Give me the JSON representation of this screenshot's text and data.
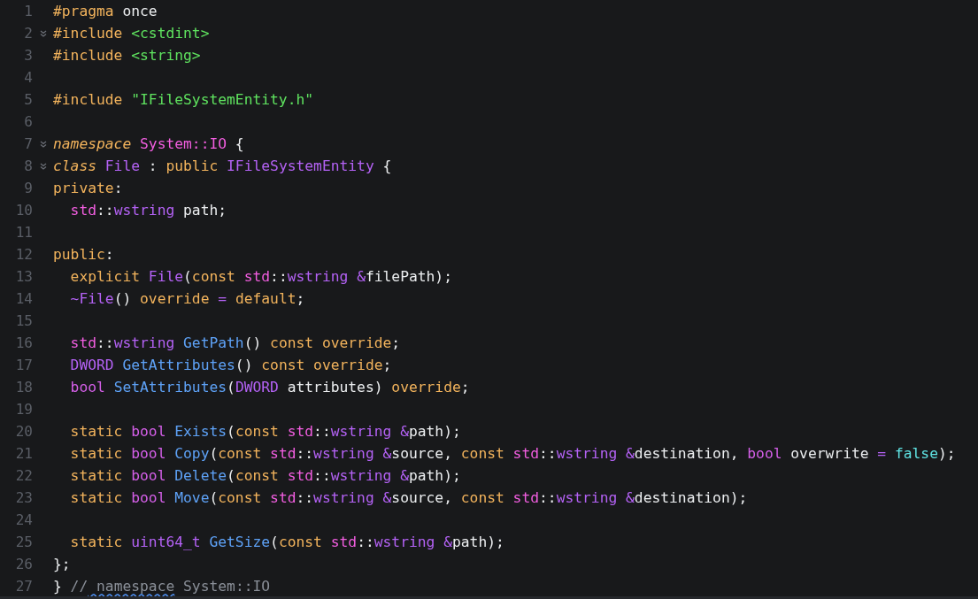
{
  "editor": {
    "lines": [
      {
        "number": "1",
        "fold": false,
        "tokens": [
          {
            "kind": "k",
            "text": "#pragma"
          },
          {
            "kind": "p",
            "text": " once"
          }
        ]
      },
      {
        "number": "2",
        "fold": true,
        "tokens": [
          {
            "kind": "k",
            "text": "#include"
          },
          {
            "kind": "s",
            "text": " <cstdint>"
          }
        ]
      },
      {
        "number": "3",
        "fold": false,
        "tokens": [
          {
            "kind": "k",
            "text": "#include"
          },
          {
            "kind": "s",
            "text": " <string>"
          }
        ]
      },
      {
        "number": "4",
        "fold": false
      },
      {
        "number": "5",
        "fold": false,
        "tokens": [
          {
            "kind": "k",
            "text": "#include"
          },
          {
            "kind": "s",
            "text": " \"IFileSystemEntity.h\""
          }
        ]
      },
      {
        "number": "6",
        "fold": false
      },
      {
        "number": "7",
        "fold": true,
        "tokens": [
          {
            "kind": "ki",
            "text": "namespace"
          },
          {
            "kind": "n",
            "text": " System::IO"
          },
          {
            "kind": "p",
            "text": " {"
          }
        ]
      },
      {
        "number": "8",
        "fold": true,
        "tokens": [
          {
            "kind": "ki",
            "text": "class"
          },
          {
            "kind": "t",
            "text": " File"
          },
          {
            "kind": "p",
            "text": " :"
          },
          {
            "kind": "k",
            "text": " public"
          },
          {
            "kind": "t",
            "text": " IFileSystemEntity"
          },
          {
            "kind": "p",
            "text": " {"
          }
        ]
      },
      {
        "number": "9",
        "fold": false,
        "tokens": [
          {
            "kind": "k",
            "text": "private"
          },
          {
            "kind": "p",
            "text": ":"
          }
        ]
      },
      {
        "number": "10",
        "fold": false,
        "tokens": [
          {
            "kind": "n",
            "text": "  std"
          },
          {
            "kind": "p",
            "text": "::"
          },
          {
            "kind": "t",
            "text": "wstring"
          },
          {
            "kind": "p",
            "text": " path;"
          }
        ]
      },
      {
        "number": "11",
        "fold": false
      },
      {
        "number": "12",
        "fold": false,
        "tokens": [
          {
            "kind": "k",
            "text": "public"
          },
          {
            "kind": "p",
            "text": ":"
          }
        ]
      },
      {
        "number": "13",
        "fold": false,
        "tokens": [
          {
            "kind": "k",
            "text": "  explicit"
          },
          {
            "kind": "t",
            "text": " File"
          },
          {
            "kind": "p",
            "text": "("
          },
          {
            "kind": "k",
            "text": "const"
          },
          {
            "kind": "n",
            "text": " std"
          },
          {
            "kind": "p",
            "text": "::"
          },
          {
            "kind": "t",
            "text": "wstring"
          },
          {
            "kind": "t",
            "text": " &"
          },
          {
            "kind": "p",
            "text": "filePath);"
          }
        ]
      },
      {
        "number": "14",
        "fold": false,
        "tokens": [
          {
            "kind": "t",
            "text": "  ~File"
          },
          {
            "kind": "p",
            "text": "()"
          },
          {
            "kind": "k",
            "text": " override"
          },
          {
            "kind": "t",
            "text": " ="
          },
          {
            "kind": "k",
            "text": " default"
          },
          {
            "kind": "p",
            "text": ";"
          }
        ]
      },
      {
        "number": "15",
        "fold": false
      },
      {
        "number": "16",
        "fold": false,
        "tokens": [
          {
            "kind": "n",
            "text": "  std"
          },
          {
            "kind": "p",
            "text": "::"
          },
          {
            "kind": "t",
            "text": "wstring"
          },
          {
            "kind": "f",
            "text": " GetPath"
          },
          {
            "kind": "p",
            "text": "()"
          },
          {
            "kind": "k",
            "text": " const override"
          },
          {
            "kind": "p",
            "text": ";"
          }
        ]
      },
      {
        "number": "17",
        "fold": false,
        "tokens": [
          {
            "kind": "t",
            "text": "  DWORD"
          },
          {
            "kind": "f",
            "text": " GetAttributes"
          },
          {
            "kind": "p",
            "text": "()"
          },
          {
            "kind": "k",
            "text": " const override"
          },
          {
            "kind": "p",
            "text": ";"
          }
        ]
      },
      {
        "number": "18",
        "fold": false,
        "tokens": [
          {
            "kind": "b",
            "text": "  bool"
          },
          {
            "kind": "f",
            "text": " SetAttributes"
          },
          {
            "kind": "p",
            "text": "("
          },
          {
            "kind": "t",
            "text": "DWORD"
          },
          {
            "kind": "p",
            "text": " attributes)"
          },
          {
            "kind": "k",
            "text": " override"
          },
          {
            "kind": "p",
            "text": ";"
          }
        ]
      },
      {
        "number": "19",
        "fold": false
      },
      {
        "number": "20",
        "fold": false,
        "tokens": [
          {
            "kind": "k",
            "text": "  static"
          },
          {
            "kind": "b",
            "text": " bool"
          },
          {
            "kind": "f",
            "text": " Exists"
          },
          {
            "kind": "p",
            "text": "("
          },
          {
            "kind": "k",
            "text": "const"
          },
          {
            "kind": "n",
            "text": " std"
          },
          {
            "kind": "p",
            "text": "::"
          },
          {
            "kind": "t",
            "text": "wstring"
          },
          {
            "kind": "t",
            "text": " &"
          },
          {
            "kind": "p",
            "text": "path);"
          }
        ]
      },
      {
        "number": "21",
        "fold": false,
        "tokens": [
          {
            "kind": "k",
            "text": "  static"
          },
          {
            "kind": "b",
            "text": " bool"
          },
          {
            "kind": "f",
            "text": " Copy"
          },
          {
            "kind": "p",
            "text": "("
          },
          {
            "kind": "k",
            "text": "const"
          },
          {
            "kind": "n",
            "text": " std"
          },
          {
            "kind": "p",
            "text": "::"
          },
          {
            "kind": "t",
            "text": "wstring"
          },
          {
            "kind": "t",
            "text": " &"
          },
          {
            "kind": "p",
            "text": "source,"
          },
          {
            "kind": "k",
            "text": " const"
          },
          {
            "kind": "n",
            "text": " std"
          },
          {
            "kind": "p",
            "text": "::"
          },
          {
            "kind": "t",
            "text": "wstring"
          },
          {
            "kind": "t",
            "text": " &"
          },
          {
            "kind": "p",
            "text": "destination,"
          },
          {
            "kind": "b",
            "text": " bool"
          },
          {
            "kind": "p",
            "text": " overwrite"
          },
          {
            "kind": "t",
            "text": " ="
          },
          {
            "kind": "c",
            "text": " false"
          },
          {
            "kind": "p",
            "text": ");"
          }
        ]
      },
      {
        "number": "22",
        "fold": false,
        "tokens": [
          {
            "kind": "k",
            "text": "  static"
          },
          {
            "kind": "b",
            "text": " bool"
          },
          {
            "kind": "f",
            "text": " Delete"
          },
          {
            "kind": "p",
            "text": "("
          },
          {
            "kind": "k",
            "text": "const"
          },
          {
            "kind": "n",
            "text": " std"
          },
          {
            "kind": "p",
            "text": "::"
          },
          {
            "kind": "t",
            "text": "wstring"
          },
          {
            "kind": "t",
            "text": " &"
          },
          {
            "kind": "p",
            "text": "path);"
          }
        ]
      },
      {
        "number": "23",
        "fold": false,
        "tokens": [
          {
            "kind": "k",
            "text": "  static"
          },
          {
            "kind": "b",
            "text": " bool"
          },
          {
            "kind": "f",
            "text": " Move"
          },
          {
            "kind": "p",
            "text": "("
          },
          {
            "kind": "k",
            "text": "const"
          },
          {
            "kind": "n",
            "text": " std"
          },
          {
            "kind": "p",
            "text": "::"
          },
          {
            "kind": "t",
            "text": "wstring"
          },
          {
            "kind": "t",
            "text": " &"
          },
          {
            "kind": "p",
            "text": "source,"
          },
          {
            "kind": "k",
            "text": " const"
          },
          {
            "kind": "n",
            "text": " std"
          },
          {
            "kind": "p",
            "text": "::"
          },
          {
            "kind": "t",
            "text": "wstring"
          },
          {
            "kind": "t",
            "text": " &"
          },
          {
            "kind": "p",
            "text": "destination);"
          }
        ]
      },
      {
        "number": "24",
        "fold": false
      },
      {
        "number": "25",
        "fold": false,
        "tokens": [
          {
            "kind": "k",
            "text": "  static"
          },
          {
            "kind": "t",
            "text": " uint64_t"
          },
          {
            "kind": "f",
            "text": " GetSize"
          },
          {
            "kind": "p",
            "text": "("
          },
          {
            "kind": "k",
            "text": "const"
          },
          {
            "kind": "n",
            "text": " std"
          },
          {
            "kind": "p",
            "text": "::"
          },
          {
            "kind": "t",
            "text": "wstring"
          },
          {
            "kind": "t",
            "text": " &"
          },
          {
            "kind": "p",
            "text": "path);"
          }
        ]
      },
      {
        "number": "26",
        "fold": false,
        "tokens": [
          {
            "kind": "p",
            "text": "};"
          }
        ]
      },
      {
        "number": "27",
        "fold": false,
        "tokens": [
          {
            "kind": "p",
            "text": "}"
          },
          {
            "kind": "m",
            "text": " //"
          },
          {
            "kind": "w",
            "text": " namespace"
          },
          {
            "kind": "m",
            "text": " System::IO"
          }
        ]
      }
    ]
  }
}
